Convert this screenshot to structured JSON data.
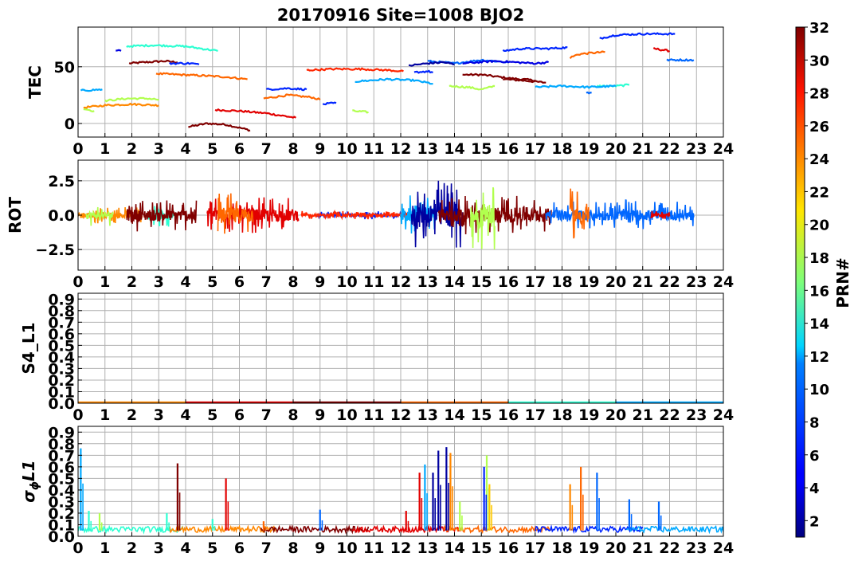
{
  "figure": {
    "title": "20170916 Site=1008 BJO2"
  },
  "chart_data": [
    {
      "type": "line",
      "panel": "TEC",
      "ylabel": "TEC",
      "xlim": [
        0,
        24
      ],
      "ylim": [
        -12,
        85
      ],
      "xticks": [
        "0",
        "1",
        "2",
        "3",
        "4",
        "5",
        "6",
        "7",
        "8",
        "9",
        "10",
        "11",
        "12",
        "13",
        "14",
        "15",
        "16",
        "17",
        "18",
        "19",
        "20",
        "21",
        "22",
        "23",
        "24"
      ],
      "yticks": [
        {
          "v": 0,
          "label": "0"
        },
        {
          "v": 50,
          "label": "50"
        }
      ],
      "grid": true,
      "series": [
        {
          "prn": 32,
          "segments": [
            [
              [
                1.9,
                53
              ],
              [
                2.5,
                54
              ],
              [
                3.2,
                55
              ],
              [
                3.7,
                54
              ]
            ],
            [
              [
                4.1,
                -3
              ],
              [
                4.8,
                0
              ],
              [
                5.5,
                -1
              ],
              [
                6.4,
                -6
              ]
            ],
            [
              [
                14.3,
                43
              ],
              [
                15.0,
                43
              ],
              [
                16.0,
                40
              ],
              [
                17.0,
                38
              ]
            ],
            [
              [
                15.8,
                39
              ],
              [
                16.5,
                38
              ],
              [
                17.4,
                36
              ]
            ]
          ]
        },
        {
          "prn": 29,
          "segments": [
            [
              [
                5.1,
                12
              ],
              [
                6.0,
                11
              ],
              [
                7.0,
                9
              ],
              [
                8.1,
                5
              ]
            ],
            [
              [
                21.4,
                66
              ],
              [
                22.0,
                64
              ]
            ]
          ]
        },
        {
          "prn": 25,
          "segments": [
            [
              [
                2.9,
                44
              ],
              [
                3.8,
                43
              ],
              [
                4.8,
                42
              ],
              [
                5.5,
                41
              ],
              [
                6.3,
                39
              ]
            ],
            [
              [
                18.3,
                58
              ],
              [
                18.6,
                61
              ],
              [
                19.0,
                62
              ],
              [
                19.6,
                63
              ]
            ],
            [
              [
                6.9,
                22
              ],
              [
                7.8,
                25
              ],
              [
                8.7,
                23
              ],
              [
                9.0,
                21
              ]
            ]
          ]
        },
        {
          "prn": 24,
          "segments": [
            [
              [
                0.2,
                14
              ],
              [
                1.0,
                16
              ],
              [
                2.0,
                17
              ],
              [
                3.0,
                16
              ]
            ]
          ]
        },
        {
          "prn": 18,
          "segments": [
            [
              [
                0.2,
                13
              ],
              [
                0.6,
                11
              ]
            ],
            [
              [
                1.0,
                20
              ],
              [
                1.8,
                22
              ],
              [
                2.6,
                22
              ],
              [
                3.0,
                21
              ]
            ],
            [
              [
                10.2,
                11
              ],
              [
                10.8,
                10
              ]
            ],
            [
              [
                13.8,
                33
              ],
              [
                14.5,
                32
              ],
              [
                15.0,
                30
              ],
              [
                15.5,
                33
              ]
            ]
          ]
        },
        {
          "prn": 14,
          "segments": [
            [
              [
                1.8,
                68
              ],
              [
                2.8,
                69
              ],
              [
                4.0,
                68
              ],
              [
                5.2,
                64
              ]
            ],
            [
              [
                19.3,
                33
              ],
              [
                20.0,
                33
              ],
              [
                20.5,
                34
              ]
            ]
          ]
        },
        {
          "prn": 10,
          "segments": [
            [
              [
                10.3,
                37
              ],
              [
                11.5,
                39
              ],
              [
                12.5,
                38
              ],
              [
                13.2,
                35
              ]
            ],
            [
              [
                17.0,
                32
              ],
              [
                18.0,
                33
              ],
              [
                19.0,
                32
              ],
              [
                20.0,
                33
              ]
            ],
            [
              [
                0.1,
                29
              ],
              [
                0.9,
                30
              ]
            ]
          ]
        },
        {
          "prn": 8,
          "segments": [
            [
              [
                13.0,
                55
              ],
              [
                14.0,
                53
              ],
              [
                15.0,
                56
              ],
              [
                16.0,
                54
              ]
            ],
            [
              [
                21.9,
                56
              ],
              [
                22.9,
                56
              ]
            ],
            [
              [
                18.9,
                27
              ],
              [
                19.1,
                27
              ]
            ]
          ]
        },
        {
          "prn": 6,
          "segments": [
            [
              [
                3.4,
                53
              ],
              [
                4.2,
                53
              ],
              [
                4.5,
                52
              ]
            ],
            [
              [
                19.4,
                75
              ],
              [
                20.0,
                78
              ],
              [
                21.0,
                79
              ],
              [
                22.2,
                79
              ]
            ],
            [
              [
                15.8,
                64
              ],
              [
                16.5,
                66
              ],
              [
                17.5,
                66
              ],
              [
                18.2,
                67
              ]
            ],
            [
              [
                7.0,
                30
              ],
              [
                7.8,
                31
              ],
              [
                8.5,
                30
              ]
            ],
            [
              [
                9.1,
                17
              ],
              [
                9.6,
                18
              ]
            ],
            [
              [
                12.5,
                45
              ],
              [
                13.0,
                46
              ],
              [
                13.2,
                45
              ]
            ]
          ]
        },
        {
          "prn": 4,
          "segments": [
            [
              [
                1.4,
                64
              ],
              [
                1.6,
                64
              ]
            ],
            [
              [
                14.3,
                53
              ],
              [
                15.5,
                55
              ],
              [
                17.0,
                53
              ],
              [
                17.5,
                54
              ]
            ]
          ]
        },
        {
          "prn": 2,
          "segments": [
            [
              [
                12.3,
                51
              ],
              [
                13.0,
                53
              ],
              [
                13.6,
                54
              ],
              [
                14.0,
                52
              ]
            ]
          ]
        },
        {
          "prn": 27,
          "segments": [
            [
              [
                8.5,
                47
              ],
              [
                9.5,
                48
              ],
              [
                10.5,
                48
              ],
              [
                11.5,
                47
              ],
              [
                12.1,
                46
              ]
            ]
          ]
        }
      ]
    },
    {
      "type": "line",
      "panel": "ROT",
      "ylabel": "ROT",
      "xlim": [
        0,
        24
      ],
      "ylim": [
        -4,
        4
      ],
      "xticks": [
        "0",
        "1",
        "2",
        "3",
        "4",
        "5",
        "6",
        "7",
        "8",
        "9",
        "10",
        "11",
        "12",
        "13",
        "14",
        "15",
        "16",
        "17",
        "18",
        "19",
        "20",
        "21",
        "22",
        "23",
        "24"
      ],
      "yticks": [
        {
          "v": 2.5,
          "label": "2.5"
        },
        {
          "v": 0,
          "label": "0.0"
        },
        {
          "v": -2.5,
          "label": "−2.5"
        }
      ],
      "grid": true,
      "activity": [
        {
          "prn": 24,
          "from": 0.0,
          "to": 2.4,
          "amp": 0.6
        },
        {
          "prn": 18,
          "from": 0.3,
          "to": 1.3,
          "amp": 0.8
        },
        {
          "prn": 14,
          "from": 2.6,
          "to": 3.6,
          "amp": 0.9
        },
        {
          "prn": 32,
          "from": 1.8,
          "to": 4.4,
          "amp": 1.2
        },
        {
          "prn": 29,
          "from": 4.8,
          "to": 8.2,
          "amp": 1.3
        },
        {
          "prn": 25,
          "from": 5.2,
          "to": 6.5,
          "amp": 1.6
        },
        {
          "prn": 6,
          "from": 8.9,
          "to": 12.2,
          "amp": 0.3
        },
        {
          "prn": 27,
          "from": 8.3,
          "to": 12.3,
          "amp": 0.3
        },
        {
          "prn": 10,
          "from": 12.0,
          "to": 13.3,
          "amp": 1.5
        },
        {
          "prn": 2,
          "from": 12.4,
          "to": 14.3,
          "amp": 2.6
        },
        {
          "prn": 32,
          "from": 13.4,
          "to": 17.6,
          "amp": 1.4
        },
        {
          "prn": 18,
          "from": 14.6,
          "to": 15.5,
          "amp": 2.6
        },
        {
          "prn": 8,
          "from": 17.4,
          "to": 22.9,
          "amp": 1.1
        },
        {
          "prn": 25,
          "from": 18.3,
          "to": 19.0,
          "amp": 2.0
        },
        {
          "prn": 29,
          "from": 21.3,
          "to": 22.0,
          "amp": 0.3
        }
      ]
    },
    {
      "type": "line",
      "panel": "S4_L1",
      "ylabel": "S4_L1",
      "xlim": [
        0,
        24
      ],
      "ylim": [
        0,
        0.95
      ],
      "xticks": [
        "0",
        "1",
        "2",
        "3",
        "4",
        "5",
        "6",
        "7",
        "8",
        "9",
        "10",
        "11",
        "12",
        "13",
        "14",
        "15",
        "16",
        "17",
        "18",
        "19",
        "20",
        "21",
        "22",
        "23",
        "24"
      ],
      "yticks": [
        {
          "v": 0.0,
          "label": "0.0"
        },
        {
          "v": 0.1,
          "label": "0.1"
        },
        {
          "v": 0.2,
          "label": "0.2"
        },
        {
          "v": 0.3,
          "label": "0.3"
        },
        {
          "v": 0.4,
          "label": "0.4"
        },
        {
          "v": 0.5,
          "label": "0.5"
        },
        {
          "v": 0.6,
          "label": "0.6"
        },
        {
          "v": 0.7,
          "label": "0.7"
        },
        {
          "v": 0.8,
          "label": "0.8"
        },
        {
          "v": 0.9,
          "label": "0.9"
        }
      ],
      "grid": true,
      "level": 0.0
    },
    {
      "type": "line",
      "panel": "sigma_phi_L1",
      "ylabel": "σ",
      "ylabel_sub": "ϕ",
      "ylabel_tail": "L1",
      "xlim": [
        0,
        24
      ],
      "ylim": [
        0,
        0.95
      ],
      "xticks": [
        "0",
        "1",
        "2",
        "3",
        "4",
        "5",
        "6",
        "7",
        "8",
        "9",
        "10",
        "11",
        "12",
        "13",
        "14",
        "15",
        "16",
        "17",
        "18",
        "19",
        "20",
        "21",
        "22",
        "23",
        "24"
      ],
      "yticks": [
        {
          "v": 0.0,
          "label": "0.0"
        },
        {
          "v": 0.1,
          "label": "0.1"
        },
        {
          "v": 0.2,
          "label": "0.2"
        },
        {
          "v": 0.3,
          "label": "0.3"
        },
        {
          "v": 0.4,
          "label": "0.4"
        },
        {
          "v": 0.5,
          "label": "0.5"
        },
        {
          "v": 0.6,
          "label": "0.6"
        },
        {
          "v": 0.7,
          "label": "0.7"
        },
        {
          "v": 0.8,
          "label": "0.8"
        },
        {
          "v": 0.9,
          "label": "0.9"
        }
      ],
      "grid": true,
      "baseline": 0.05,
      "spikes": [
        {
          "x": 0.1,
          "y": 0.76,
          "prn": 10
        },
        {
          "x": 0.4,
          "y": 0.22,
          "prn": 14
        },
        {
          "x": 0.8,
          "y": 0.2,
          "prn": 18
        },
        {
          "x": 3.3,
          "y": 0.2,
          "prn": 14
        },
        {
          "x": 3.7,
          "y": 0.63,
          "prn": 32
        },
        {
          "x": 5.0,
          "y": 0.15,
          "prn": 14
        },
        {
          "x": 5.5,
          "y": 0.5,
          "prn": 29
        },
        {
          "x": 6.9,
          "y": 0.13,
          "prn": 25
        },
        {
          "x": 9.0,
          "y": 0.23,
          "prn": 8
        },
        {
          "x": 12.2,
          "y": 0.22,
          "prn": 29
        },
        {
          "x": 12.7,
          "y": 0.55,
          "prn": 29
        },
        {
          "x": 12.9,
          "y": 0.62,
          "prn": 10
        },
        {
          "x": 13.2,
          "y": 0.55,
          "prn": 2
        },
        {
          "x": 13.4,
          "y": 0.74,
          "prn": 2
        },
        {
          "x": 13.7,
          "y": 0.77,
          "prn": 2
        },
        {
          "x": 13.85,
          "y": 0.72,
          "prn": 24
        },
        {
          "x": 14.2,
          "y": 0.3,
          "prn": 18
        },
        {
          "x": 15.2,
          "y": 0.7,
          "prn": 18
        },
        {
          "x": 15.1,
          "y": 0.6,
          "prn": 6
        },
        {
          "x": 15.3,
          "y": 0.45,
          "prn": 22
        },
        {
          "x": 18.3,
          "y": 0.45,
          "prn": 24
        },
        {
          "x": 18.7,
          "y": 0.6,
          "prn": 25
        },
        {
          "x": 19.3,
          "y": 0.55,
          "prn": 8
        },
        {
          "x": 20.5,
          "y": 0.32,
          "prn": 8
        },
        {
          "x": 21.6,
          "y": 0.3,
          "prn": 8
        }
      ]
    }
  ],
  "colorbar": {
    "label": "PRN#",
    "min": 1,
    "max": 32,
    "ticks": [
      "2",
      "4",
      "6",
      "8",
      "10",
      "12",
      "14",
      "16",
      "18",
      "20",
      "22",
      "24",
      "26",
      "28",
      "30",
      "32"
    ]
  }
}
